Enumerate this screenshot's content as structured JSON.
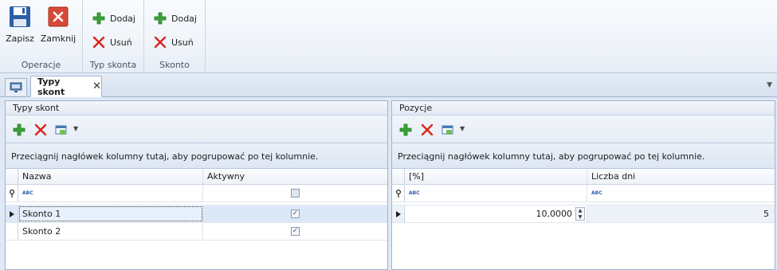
{
  "ribbon": {
    "groups": [
      {
        "title": "Operacje",
        "buttons": [
          {
            "label": "Zapisz",
            "icon": "save-icon"
          },
          {
            "label": "Zamknij",
            "icon": "close-window-icon"
          }
        ]
      },
      {
        "title": "Typ skonta",
        "buttons": [
          {
            "label": "Dodaj",
            "icon": "plus-icon"
          },
          {
            "label": "Usuń",
            "icon": "delete-x-icon"
          }
        ]
      },
      {
        "title": "Skonto",
        "buttons": [
          {
            "label": "Dodaj",
            "icon": "plus-icon"
          },
          {
            "label": "Usuń",
            "icon": "delete-x-icon"
          }
        ]
      }
    ]
  },
  "tabs": [
    {
      "label": "Typy skont",
      "active": true
    }
  ],
  "left_panel": {
    "title": "Typy skont",
    "group_hint": "Przeciągnij nagłówek kolumny tutaj, aby pogrupować po tej kolumnie.",
    "columns": [
      "Nazwa",
      "Aktywny"
    ],
    "filter_token": "ABC",
    "rows": [
      {
        "name": "Skonto 1",
        "active": true,
        "selected": true
      },
      {
        "name": "Skonto 2",
        "active": true,
        "selected": false
      }
    ]
  },
  "right_panel": {
    "title": "Pozycje",
    "group_hint": "Przeciągnij nagłówek kolumny tutaj, aby pogrupować po tej kolumnie.",
    "columns": [
      "[%]",
      "Liczba dni"
    ],
    "filter_token": "ABC",
    "rows": [
      {
        "percent": "10,0000",
        "days": "5",
        "selected": true
      }
    ]
  },
  "colors": {
    "accent": "#2f5fa8",
    "add": "#3aa335",
    "delete": "#d9261c",
    "panel_border": "#9fb3cf"
  }
}
